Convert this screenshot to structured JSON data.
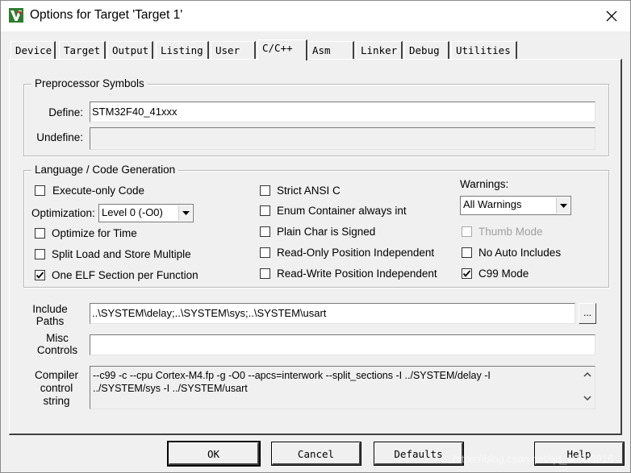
{
  "window": {
    "title": "Options for Target 'Target 1'"
  },
  "icons": {
    "app": "keil-uvision-icon",
    "close": "close-icon",
    "dropdown": "chevron-down-icon",
    "check": "checkmark-icon",
    "scroll_up": "scroll-up-icon",
    "scroll_down": "scroll-down-icon"
  },
  "tabs": [
    {
      "label": "Device"
    },
    {
      "label": "Target"
    },
    {
      "label": "Output"
    },
    {
      "label": "Listing"
    },
    {
      "label": "User"
    },
    {
      "label": "C/C++"
    },
    {
      "label": "Asm"
    },
    {
      "label": "Linker"
    },
    {
      "label": "Debug"
    },
    {
      "label": "Utilities"
    }
  ],
  "active_tab": "C/C++",
  "preprocessor": {
    "group_label": "Preprocessor Symbols",
    "define_label": "Define:",
    "define_value": "STM32F40_41xxx",
    "undefine_label": "Undefine:",
    "undefine_value": ""
  },
  "codegen": {
    "group_label": "Language / Code Generation",
    "execute_only": {
      "label": "Execute-only Code",
      "checked": false
    },
    "optimization_label": "Optimization:",
    "optimization_value": "Level 0 (-O0)",
    "optimize_time": {
      "label": "Optimize for Time",
      "checked": false
    },
    "split_load_store": {
      "label": "Split Load and Store Multiple",
      "checked": false
    },
    "one_elf": {
      "label": "One ELF Section per Function",
      "checked": true
    },
    "strict_ansi": {
      "label": "Strict ANSI C",
      "checked": false
    },
    "enum_container": {
      "label": "Enum Container always int",
      "checked": false
    },
    "plain_char": {
      "label": "Plain Char is Signed",
      "checked": false
    },
    "ro_pi": {
      "label": "Read-Only Position Independent",
      "checked": false
    },
    "rw_pi": {
      "label": "Read-Write Position Independent",
      "checked": false
    },
    "warnings_label": "Warnings:",
    "warnings_value": "All Warnings",
    "thumb_mode": {
      "label": "Thumb Mode",
      "checked": false,
      "disabled": true
    },
    "no_auto_includes": {
      "label": "No Auto Includes",
      "checked": false
    },
    "c99_mode": {
      "label": "C99 Mode",
      "checked": true
    }
  },
  "paths": {
    "include_label_1": "Include",
    "include_label_2": "Paths",
    "include_value": "..\\SYSTEM\\delay;..\\SYSTEM\\sys;..\\SYSTEM\\usart",
    "browse_label": "...",
    "misc_label_1": "Misc",
    "misc_label_2": "Controls",
    "misc_value": "",
    "compiler_label_1": "Compiler",
    "compiler_label_2": "control",
    "compiler_label_3": "string",
    "compiler_line_1": "--c99 -c --cpu Cortex-M4.fp -g -O0 --apcs=interwork --split_sections -I ../SYSTEM/delay -I",
    "compiler_line_2": "../SYSTEM/sys -I ../SYSTEM/usart"
  },
  "buttons": {
    "ok": "OK",
    "cancel": "Cancel",
    "defaults": "Defaults",
    "help": "Help"
  },
  "watermark": "https://blog.csdn.net/qq_40093916"
}
